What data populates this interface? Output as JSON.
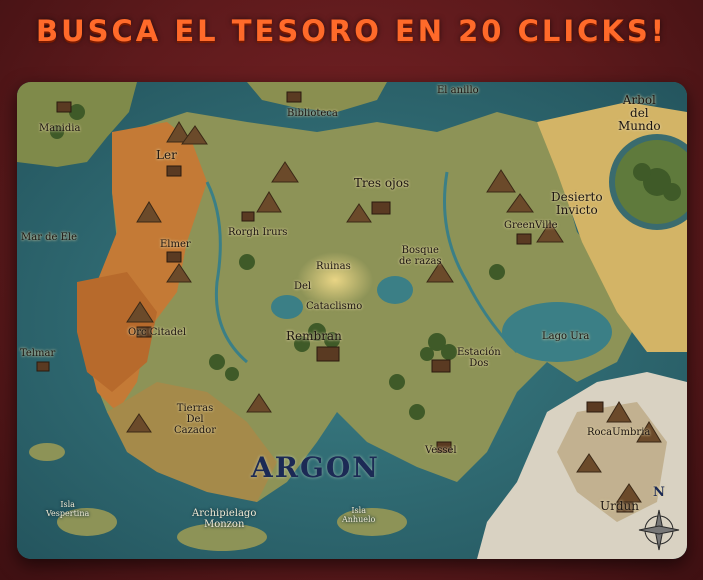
{
  "header": {
    "title": "BUSCA EL TESORO EN 20 CLICKS!"
  },
  "map": {
    "name": "ARGON",
    "places": {
      "manidia": "Manidia",
      "biblioteca": "Biblioteca",
      "el_anillo": "El anillo",
      "arbol_line1": "Arbol",
      "arbol_line2": "del",
      "arbol_line3": "Mundo",
      "ler": "Ler",
      "tres_ojos": "Tres ojos",
      "desierto_line1": "Desierto",
      "desierto_line2": "Invicto",
      "mar_de_ele": "Mar de Ele",
      "elmer": "Elmer",
      "rorgh_irurs": "Rorgh Irurs",
      "greenville": "GreenVille",
      "bosque_line1": "Bosque",
      "bosque_line2": "de razas",
      "ruinas": "Ruinas",
      "del": "Del",
      "cataclismo": "Cataclismo",
      "lago_ura": "Lago Ura",
      "orc_citadel": "Orc Citadel",
      "rembran": "Rembran",
      "telmar": "Telmar",
      "estacion_line1": "Estación",
      "estacion_line2": "Dos",
      "tierras_line1": "Tierras",
      "tierras_line2": "Del",
      "tierras_line3": "Cazador",
      "rocaumbria": "RocaUmbria",
      "vessel": "Vessel",
      "isla_vespertina_line1": "Isla",
      "isla_vespertina_line2": "Vespertina",
      "archipielago_line1": "Archipielago",
      "archipielago_line2": "Monzon",
      "isla_anhuelo_line1": "Isla",
      "isla_anhuelo_line2": "Anhuelo",
      "urdun": "Urdun",
      "compass_letter": "N"
    }
  }
}
